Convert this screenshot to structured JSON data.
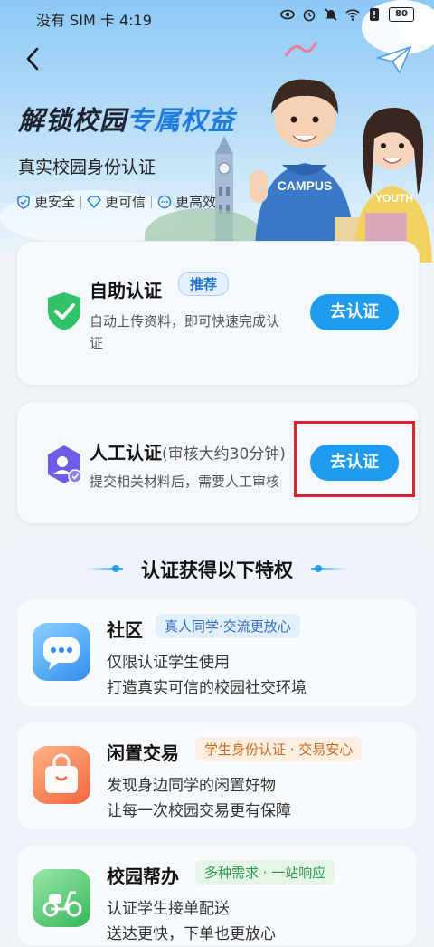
{
  "status_bar": {
    "carrier_time": "没有 SIM 卡 4:19",
    "battery": "80"
  },
  "hero": {
    "title_plain": "解锁校园",
    "title_highlight": "专属权益",
    "subtitle": "真实校园身份认证",
    "badges": [
      {
        "icon": "shield-icon",
        "label": "更安全"
      },
      {
        "icon": "diamond-icon",
        "label": "更可信"
      },
      {
        "icon": "chat-icon",
        "label": "更高效"
      }
    ],
    "shirt_text_1": "CAMPUS",
    "shirt_text_2": "YOUTH"
  },
  "self_cert": {
    "title": "自助认证",
    "tag": "推荐",
    "desc_line1": "自动上传资料，即可快速完成认",
    "desc_line2": "证",
    "button": "去认证"
  },
  "manual_cert": {
    "title": "人工认证",
    "note": "(审核大约30分钟)",
    "desc": "提交相关材料后，需要人工审核",
    "button": "去认证"
  },
  "privileges": {
    "heading": "认证获得以下特权",
    "items": [
      {
        "title": "社区",
        "tag": "真人同学·交流更放心",
        "line1": "仅限认证学生使用",
        "line2": "打造真实可信的校园社交环境"
      },
      {
        "title": "闲置交易",
        "tag": "学生身份认证 · 交易安心",
        "line1": "发现身边同学的闲置好物",
        "line2": "让每一次校园交易更有保障"
      },
      {
        "title": "校园帮办",
        "tag": "多种需求 · 一站响应",
        "line1": "认证学生接单配送",
        "line2": "送达更快，下单也更放心"
      }
    ]
  },
  "colors": {
    "accent": "#1f9bf0",
    "highlight_box": "#d7262e",
    "title_blue": "#1f7de0"
  }
}
